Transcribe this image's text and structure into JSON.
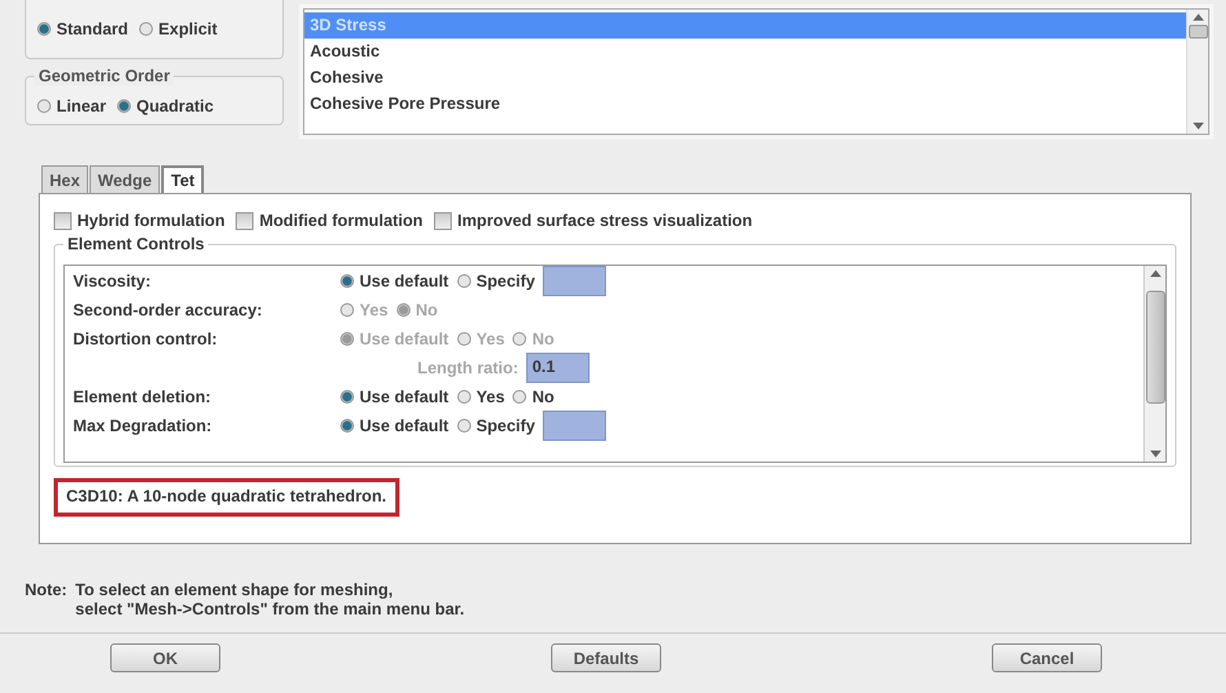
{
  "formulation": {
    "options": [
      {
        "label": "Standard",
        "selected": true
      },
      {
        "label": "Explicit",
        "selected": false
      }
    ]
  },
  "geometric_order": {
    "title": "Geometric Order",
    "options": [
      {
        "label": "Linear",
        "selected": false
      },
      {
        "label": "Quadratic",
        "selected": true
      }
    ]
  },
  "family_list": {
    "items": [
      {
        "label": "3D Stress",
        "selected": true
      },
      {
        "label": "Acoustic",
        "selected": false
      },
      {
        "label": "Cohesive",
        "selected": false
      },
      {
        "label": "Cohesive Pore Pressure",
        "selected": false
      }
    ]
  },
  "tabs": [
    {
      "label": "Hex",
      "selected": false
    },
    {
      "label": "Wedge",
      "selected": false
    },
    {
      "label": "Tet",
      "selected": true
    }
  ],
  "checkboxes": [
    {
      "label": "Hybrid formulation",
      "checked": false
    },
    {
      "label": "Modified formulation",
      "checked": false
    },
    {
      "label": "Improved surface stress visualization",
      "checked": false
    }
  ],
  "element_controls": {
    "title": "Element Controls",
    "rows": [
      {
        "kind": "radios",
        "label": "Viscosity:",
        "disabled": false,
        "field": true,
        "options": [
          {
            "label": "Use default",
            "selected": true
          },
          {
            "label": "Specify",
            "selected": false
          }
        ]
      },
      {
        "kind": "radios",
        "label": "Second-order accuracy:",
        "disabled": false,
        "field": false,
        "options": [
          {
            "label": "Yes",
            "selected": false,
            "disabled": true
          },
          {
            "label": "No",
            "selected": true,
            "disabled": true
          }
        ]
      },
      {
        "kind": "radios",
        "label": "Distortion control:",
        "disabled": false,
        "field": false,
        "options": [
          {
            "label": "Use default",
            "selected": true,
            "disabled": true
          },
          {
            "label": "Yes",
            "selected": false,
            "disabled": true
          },
          {
            "label": "No",
            "selected": false,
            "disabled": true
          }
        ]
      },
      {
        "kind": "ratio",
        "label": "Length ratio:",
        "disabled": true,
        "value": "0.1"
      },
      {
        "kind": "radios",
        "label": "Element deletion:",
        "disabled": false,
        "field": false,
        "options": [
          {
            "label": "Use default",
            "selected": true,
            "disabled": false
          },
          {
            "label": "Yes",
            "selected": false,
            "disabled": false
          },
          {
            "label": "No",
            "selected": false,
            "disabled": false
          }
        ]
      },
      {
        "kind": "radios",
        "label": "Max Degradation:",
        "disabled": false,
        "field": true,
        "options": [
          {
            "label": "Use default",
            "selected": true,
            "disabled": false
          },
          {
            "label": "Specify",
            "selected": false,
            "disabled": false
          }
        ]
      }
    ]
  },
  "description": "C3D10:  A 10-node quadratic tetrahedron.",
  "note": {
    "label": "Note:",
    "lines": [
      "To select an element shape for meshing,",
      "select \"Mesh->Controls\" from the main menu bar."
    ]
  },
  "buttons": [
    "OK",
    "Defaults",
    "Cancel"
  ]
}
